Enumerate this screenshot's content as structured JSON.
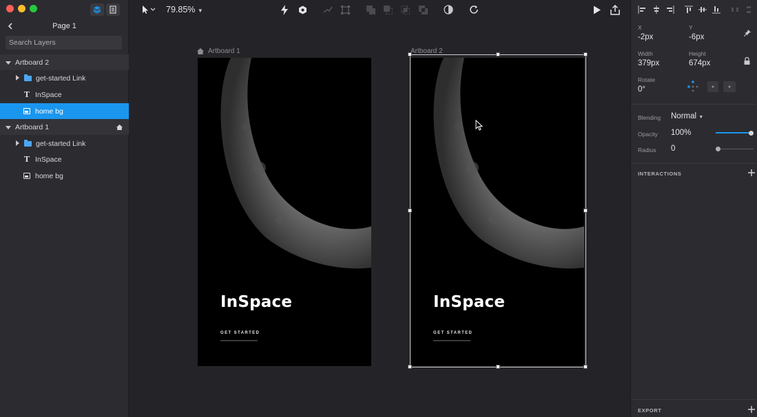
{
  "left_panel": {
    "page_title": "Page 1",
    "search_placeholder": "Search Layers",
    "layers": [
      {
        "label": "Artboard 2",
        "type": "artboard"
      },
      {
        "label": "get-started Link",
        "type": "group"
      },
      {
        "label": "InSpace",
        "type": "text"
      },
      {
        "label": "home bg",
        "type": "image",
        "selected": true
      },
      {
        "label": "Artboard 1",
        "type": "artboard",
        "home": true
      },
      {
        "label": "get-started Link",
        "type": "group"
      },
      {
        "label": "InSpace",
        "type": "text"
      },
      {
        "label": "home bg",
        "type": "image"
      }
    ]
  },
  "toolbar": {
    "zoom": "79.85%"
  },
  "canvas": {
    "artboards": [
      {
        "label": "Artboard 1",
        "title": "InSpace",
        "link": "GET STARTED"
      },
      {
        "label": "Artboard 2",
        "title": "InSpace",
        "link": "GET STARTED"
      }
    ]
  },
  "inspector": {
    "x_label": "X",
    "x_value": "-2px",
    "y_label": "Y",
    "y_value": "-6px",
    "width_label": "Width",
    "width_value": "379px",
    "height_label": "Height",
    "height_value": "674px",
    "rotate_label": "Rotate",
    "rotate_value": "0°",
    "blending_label": "Blending",
    "blending_value": "Normal",
    "opacity_label": "Opacity",
    "opacity_value": "100%",
    "opacity_level": 1.0,
    "radius_label": "Radius",
    "radius_value": "0",
    "radius_level": 0,
    "interactions_title": "INTERACTIONS",
    "export_title": "EXPORT"
  },
  "colors": {
    "accent": "#1a96ef",
    "panel": "#2c2c30",
    "canvas": "#242428"
  }
}
